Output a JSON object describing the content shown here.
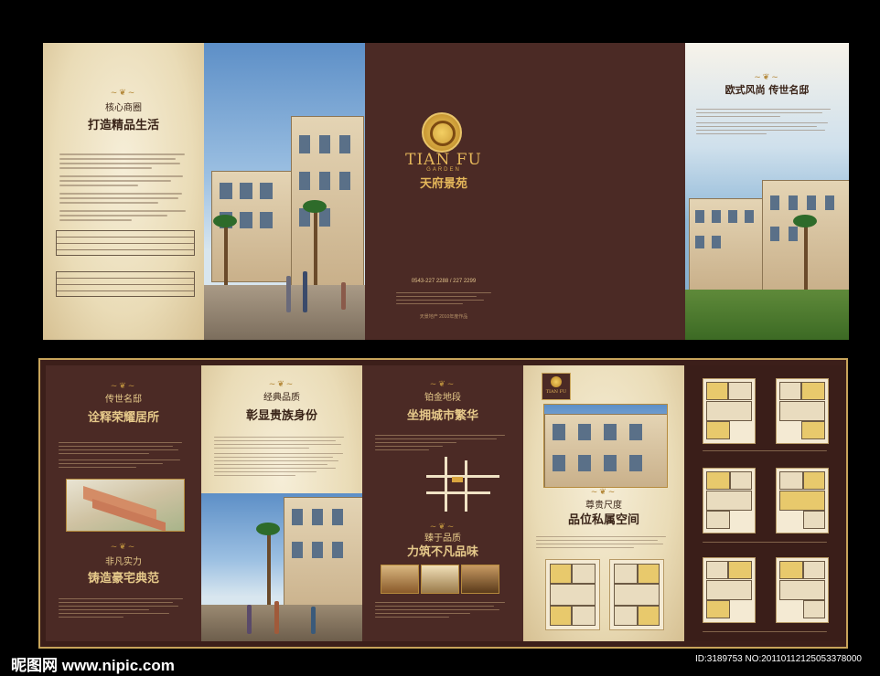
{
  "watermark": {
    "site_label": "昵图网 www.nipic.com",
    "id_label": "ID:3189753 NO:20110112125053378000"
  },
  "brand": {
    "logo_latin": "TIAN FU",
    "logo_garden": "GARDEN",
    "logo_cn": "天府景苑",
    "small_logo_latin": "TIAN FU"
  },
  "top": {
    "left_panel": {
      "subtitle": "核心商圈",
      "title": "打造精品生活"
    },
    "cover": {
      "phone": "0543-227 2288 / 227 2299",
      "footer": "天景地产  2010年度作品"
    },
    "right_panel": {
      "title": "欧式风尚  传世名邸"
    }
  },
  "bottom": {
    "p1": {
      "subtitle": "传世名邸",
      "title": "诠释荣耀居所",
      "subtitle2": "非凡实力",
      "title2": "铸造豪宅典范"
    },
    "p2": {
      "subtitle": "经典品质",
      "title": "彰显贵族身份"
    },
    "p3": {
      "subtitle": "铂金地段",
      "title": "坐拥城市繁华",
      "subtitle2": "臻于品质",
      "title2": "力筑不凡品味"
    },
    "p4": {
      "subtitle": "尊贵尺度",
      "title": "品位私属空间"
    }
  },
  "colors": {
    "brown": "#4b2a25",
    "gold": "#c8a45a",
    "parchment": "#eadcb7"
  }
}
